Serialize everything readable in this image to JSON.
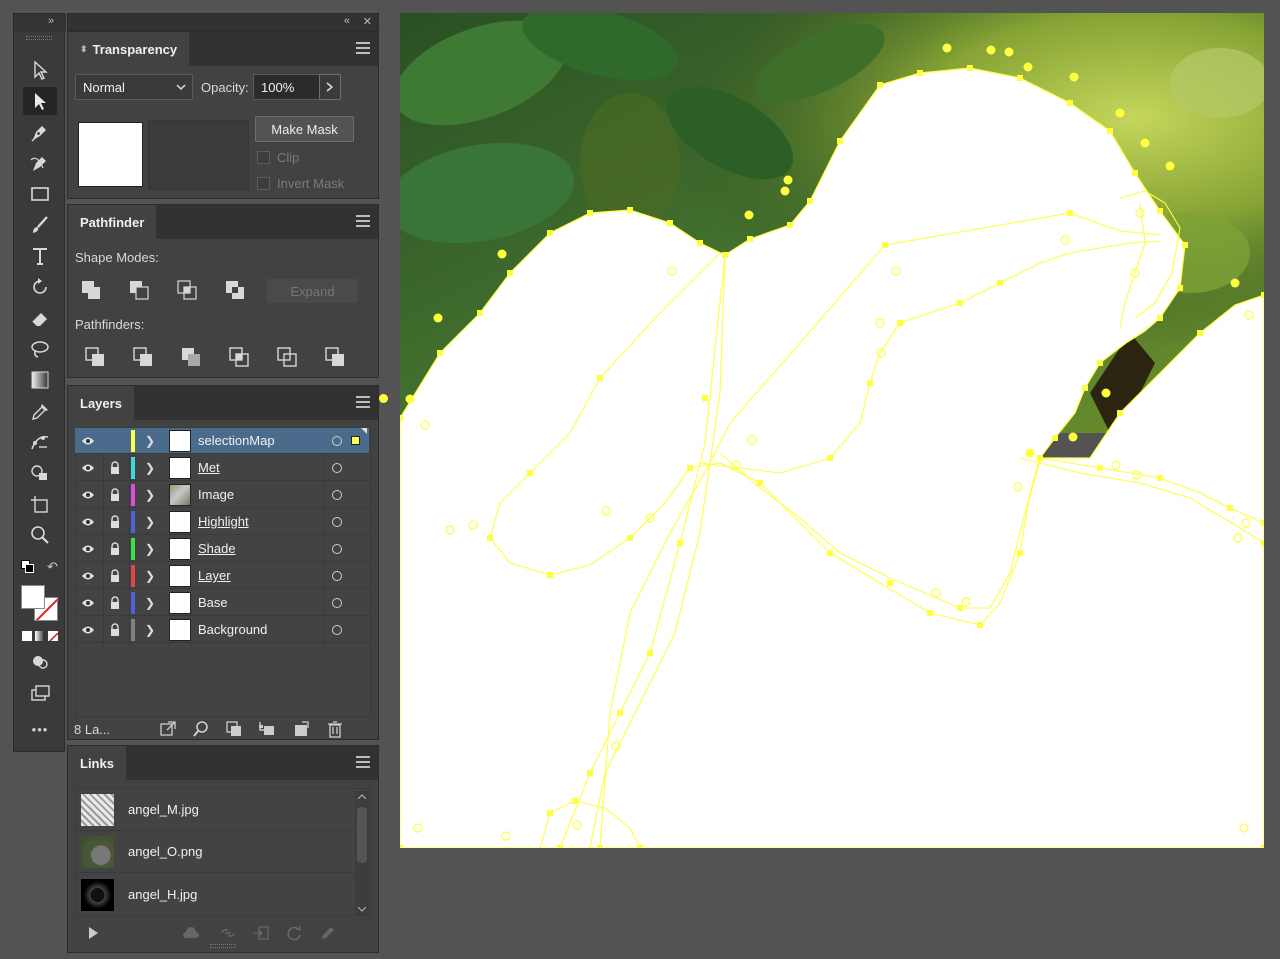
{
  "toolbar": {
    "collapse_label": "»",
    "tools": [
      {
        "icon": "selection-tool-icon"
      },
      {
        "icon": "direct-selection-tool-icon",
        "active": true
      },
      {
        "icon": "pen-tool-icon"
      },
      {
        "icon": "curvature-tool-icon"
      },
      {
        "icon": "rectangle-tool-icon"
      },
      {
        "icon": "paintbrush-tool-icon"
      },
      {
        "icon": "type-tool-icon"
      },
      {
        "icon": "rotate-tool-icon"
      },
      {
        "icon": "eraser-tool-icon"
      },
      {
        "icon": "lasso-tool-icon"
      },
      {
        "icon": "gradient-tool-icon"
      },
      {
        "icon": "eyedropper-tool-icon"
      },
      {
        "icon": "puppet-warp-tool-icon"
      },
      {
        "icon": "shape-builder-tool-icon"
      },
      {
        "icon": "artboard-tool-icon"
      },
      {
        "icon": "zoom-tool-icon"
      }
    ],
    "more_label": "•••"
  },
  "dock": {
    "collapse_label": "«",
    "close_label": "✕"
  },
  "transparency": {
    "tab_label": "Transparency",
    "blend_mode": "Normal",
    "opacity_label": "Opacity:",
    "opacity_value": "100%",
    "make_mask_label": "Make Mask",
    "clip_label": "Clip",
    "invert_mask_label": "Invert Mask"
  },
  "pathfinder": {
    "tab_label": "Pathfinder",
    "shape_modes_label": "Shape Modes:",
    "expand_label": "Expand",
    "pathfinders_label": "Pathfinders:"
  },
  "layers": {
    "tab_label": "Layers",
    "items": [
      {
        "name": "selectionMap",
        "color": "#ffff40",
        "locked": false,
        "selected": true,
        "underline": false
      },
      {
        "name": "Met",
        "color": "#3fd8d8",
        "locked": true,
        "selected": false,
        "underline": true
      },
      {
        "name": "Image",
        "color": "#d84fd8",
        "locked": true,
        "selected": false,
        "underline": false
      },
      {
        "name": "Highlight",
        "color": "#4f5fe0",
        "locked": true,
        "selected": false,
        "underline": true
      },
      {
        "name": "Shade",
        "color": "#3ee04a",
        "locked": true,
        "selected": false,
        "underline": true
      },
      {
        "name": "Layer",
        "color": "#e04444",
        "locked": true,
        "selected": false,
        "underline": true
      },
      {
        "name": "Base",
        "color": "#4f5fe0",
        "locked": true,
        "selected": false,
        "underline": false
      },
      {
        "name": "Background",
        "color": "#808080",
        "locked": true,
        "selected": false,
        "underline": false
      }
    ],
    "count_label": "8 La..."
  },
  "links": {
    "tab_label": "Links",
    "items": [
      {
        "name": "angel_M.jpg"
      },
      {
        "name": "angel_O.png"
      },
      {
        "name": "angel_H.jpg"
      }
    ]
  },
  "colors": {
    "selection_path": "#ffff40",
    "panel_bg": "#424242",
    "app_bg": "#535353",
    "selected_row": "#4b6b8c"
  }
}
